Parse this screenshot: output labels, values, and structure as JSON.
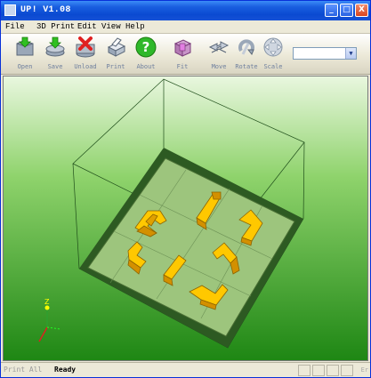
{
  "window": {
    "title": "UP! V1.08",
    "controls": {
      "minimize": "_",
      "maximize": "□",
      "close": "X"
    }
  },
  "menu": {
    "items": [
      {
        "label": "File"
      },
      {
        "label": "3D Print"
      },
      {
        "label": "Edit"
      },
      {
        "label": "View"
      },
      {
        "label": "Help"
      }
    ]
  },
  "toolbar": {
    "tools": [
      {
        "label": "Open",
        "icon": "open-icon"
      },
      {
        "label": "Save",
        "icon": "save-icon"
      },
      {
        "label": "Unload",
        "icon": "unload-icon"
      },
      {
        "label": "Print",
        "icon": "print-icon"
      },
      {
        "label": "About",
        "icon": "about-icon"
      },
      {
        "label": "Fit",
        "icon": "fit-icon"
      },
      {
        "label": "Move",
        "icon": "move-icon"
      },
      {
        "label": "Rotate",
        "icon": "rotate-icon"
      },
      {
        "label": "Scale",
        "icon": "scale-icon"
      }
    ],
    "combo_value": "",
    "combo_arrow": "▼"
  },
  "viewport": {
    "background_top": "#ffffff",
    "background_bottom": "#1c8a12",
    "platform_color": "#9bc07a",
    "part_color": "#ffcc00",
    "axis_label_z": "Z"
  },
  "status": {
    "left_text": "Print All",
    "ready_text": "Ready",
    "right_text": "Er"
  }
}
